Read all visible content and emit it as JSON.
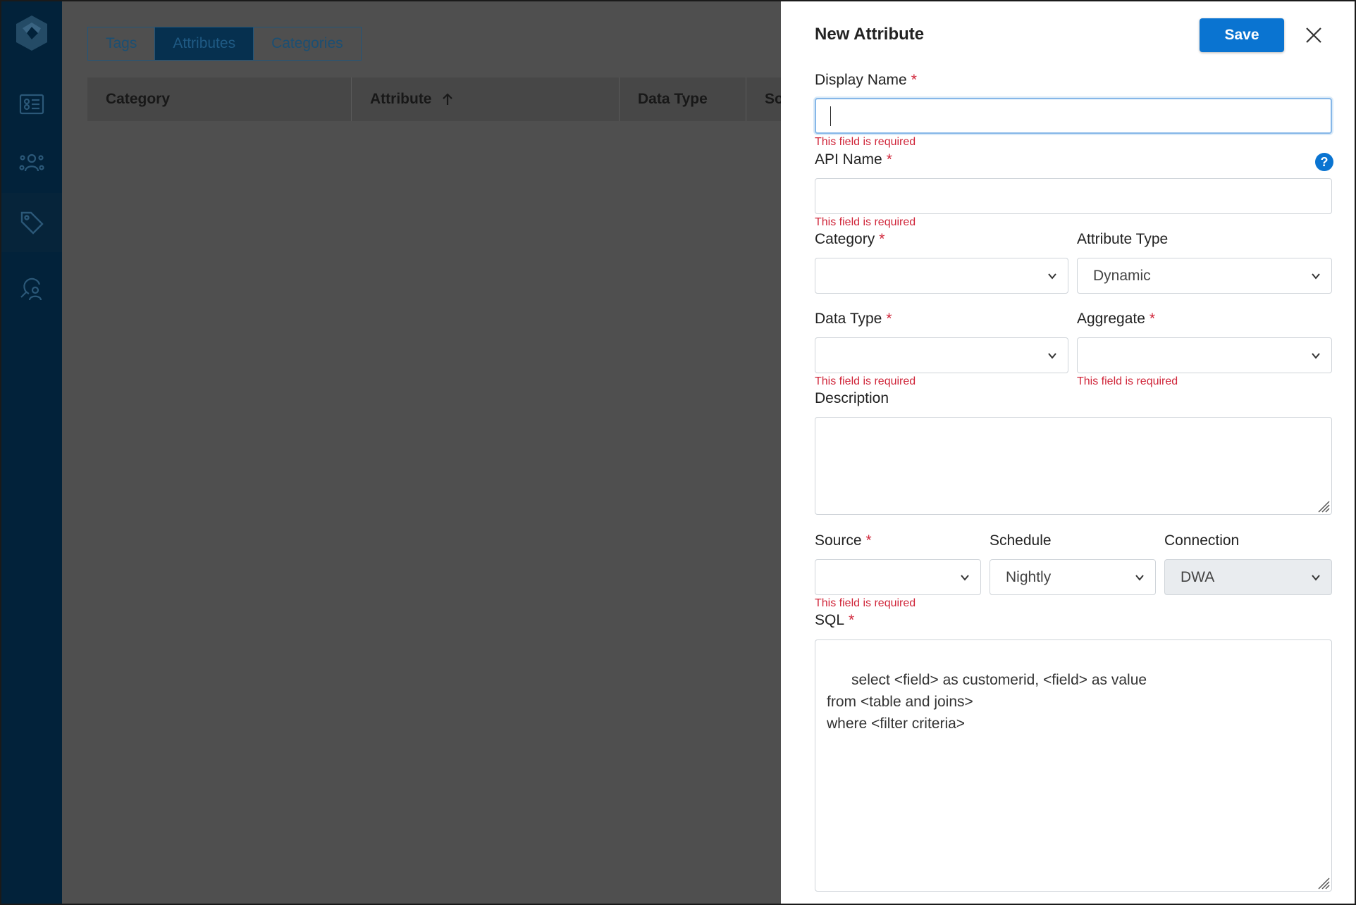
{
  "sidebar": {
    "items": [
      {
        "name": "contact-card-icon"
      },
      {
        "name": "audience-icon"
      },
      {
        "name": "tag-icon",
        "active": true
      },
      {
        "name": "user-search-icon"
      }
    ]
  },
  "background": {
    "tabs": [
      {
        "label": "Tags"
      },
      {
        "label": "Attributes",
        "active": true
      },
      {
        "label": "Categories"
      }
    ],
    "columns": [
      {
        "label": "Category"
      },
      {
        "label": "Attribute",
        "sort": "ascending"
      },
      {
        "label": "Data Type"
      },
      {
        "label": "So"
      }
    ]
  },
  "panel": {
    "title": "New Attribute",
    "save_label": "Save",
    "error_text": "This field is required",
    "display_name": {
      "label": "Display Name",
      "required_mark": "*",
      "value": ""
    },
    "api_name": {
      "label": "API Name",
      "required_mark": "*",
      "help": "?",
      "value": ""
    },
    "category": {
      "label": "Category",
      "required_mark": "*",
      "value": ""
    },
    "attribute_type": {
      "label": "Attribute Type",
      "value": "Dynamic"
    },
    "data_type": {
      "label": "Data Type",
      "required_mark": "*",
      "value": ""
    },
    "aggregate": {
      "label": "Aggregate",
      "required_mark": "*",
      "value": ""
    },
    "description": {
      "label": "Description",
      "value": ""
    },
    "source": {
      "label": "Source",
      "required_mark": "*",
      "value": ""
    },
    "schedule": {
      "label": "Schedule",
      "value": "Nightly"
    },
    "connection": {
      "label": "Connection",
      "value": "DWA"
    },
    "sql": {
      "label": "SQL",
      "required_mark": "*",
      "value": "select <field> as customerid, <field> as value\nfrom <table and joins>\nwhere <filter criteria>"
    }
  },
  "colors": {
    "accent": "#0a74d1",
    "error": "#d0263a",
    "sidebar": "#02223a"
  }
}
